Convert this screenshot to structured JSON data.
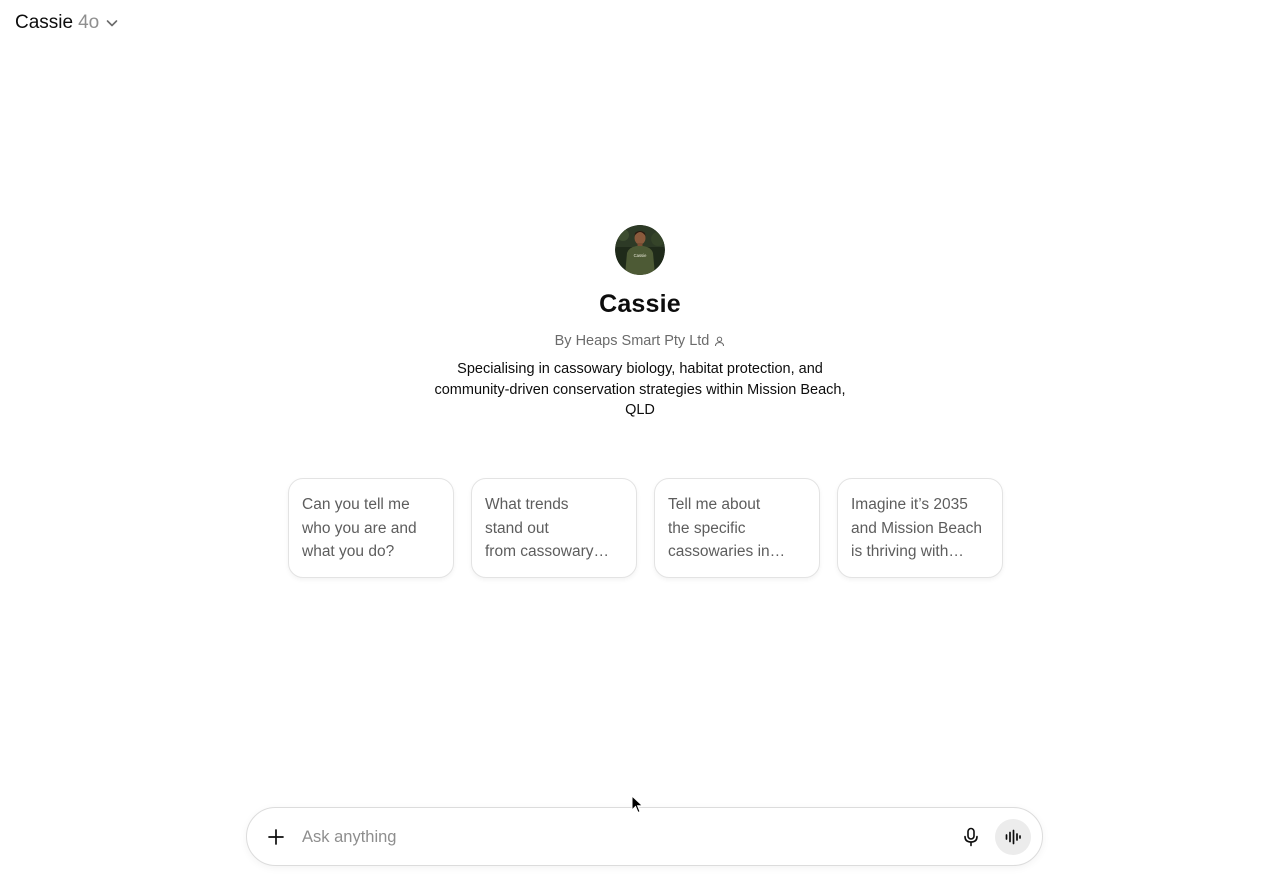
{
  "header": {
    "model_name": "Cassie",
    "model_version": "4o",
    "chevron_icon": "chevron-down-icon"
  },
  "profile": {
    "avatar_icon": "avatar-photo",
    "avatar_shirt_text": "Cassie",
    "title": "Cassie",
    "author": "By Heaps Smart Pty Ltd",
    "author_icon": "person-icon",
    "description": "Specialising in cassowary biology, habitat protection, and community-driven conservation strategies within Mission Beach, QLD"
  },
  "suggestions": [
    {
      "text": "Can you tell me\nwho you are and\nwhat you do?"
    },
    {
      "text": "What trends\nstand out\nfrom cassowary…"
    },
    {
      "text": "Tell me about\nthe specific\ncassowaries in…"
    },
    {
      "text": "Imagine it’s 2035\nand Mission Beach\nis thriving with…"
    }
  ],
  "composer": {
    "placeholder": "Ask anything",
    "value": "",
    "plus_icon": "plus-icon",
    "mic_icon": "microphone-icon",
    "voice_icon": "voice-waveform-icon"
  },
  "colors": {
    "text_primary": "#0d0d0d",
    "text_secondary": "#6b6b6b",
    "card_border": "#e3e3e3",
    "voice_button_bg": "#ececec",
    "avatar_shirt": "#4d5a35"
  }
}
